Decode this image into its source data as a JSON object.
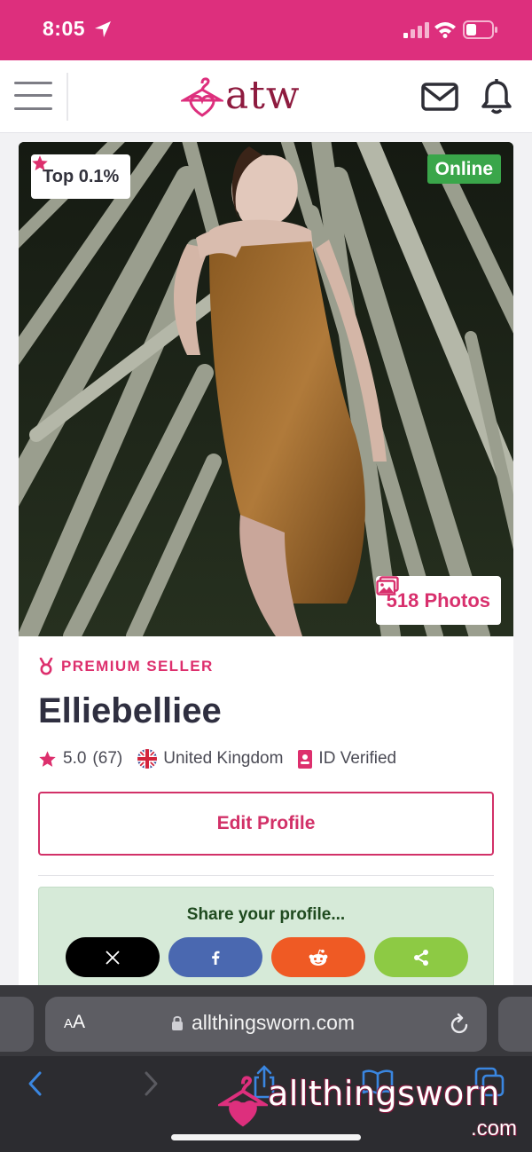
{
  "status_bar": {
    "time": "8:05"
  },
  "header": {
    "logo_text": "atw"
  },
  "profile": {
    "rank_badge": "Top 0.1%",
    "status_badge": "Online",
    "photos_label": "518 Photos",
    "seller_tier": "PREMIUM SELLER",
    "username": "Elliebelliee",
    "rating": "5.0",
    "review_count": "(67)",
    "country": "United Kingdom",
    "verification": "ID Verified",
    "edit_label": "Edit Profile"
  },
  "share": {
    "title": "Share your profile...",
    "buttons": [
      {
        "name": "x",
        "icon": "x-logo-icon",
        "color": "#000000"
      },
      {
        "name": "facebook",
        "icon": "facebook-icon",
        "color": "#4a68b0"
      },
      {
        "name": "reddit",
        "icon": "reddit-icon",
        "color": "#ef5a24"
      },
      {
        "name": "share",
        "icon": "share-icon",
        "color": "#8dca44"
      }
    ]
  },
  "browser": {
    "text_size_label": "AA",
    "url": "allthingsworn.com"
  },
  "watermark": {
    "main": "allthingsworn",
    "suffix": ".com"
  },
  "colors": {
    "brand_pink": "#dd2f7d",
    "brand_maroon": "#8e1b3f",
    "online_green": "#3aa64a",
    "accent": "#d23168"
  }
}
